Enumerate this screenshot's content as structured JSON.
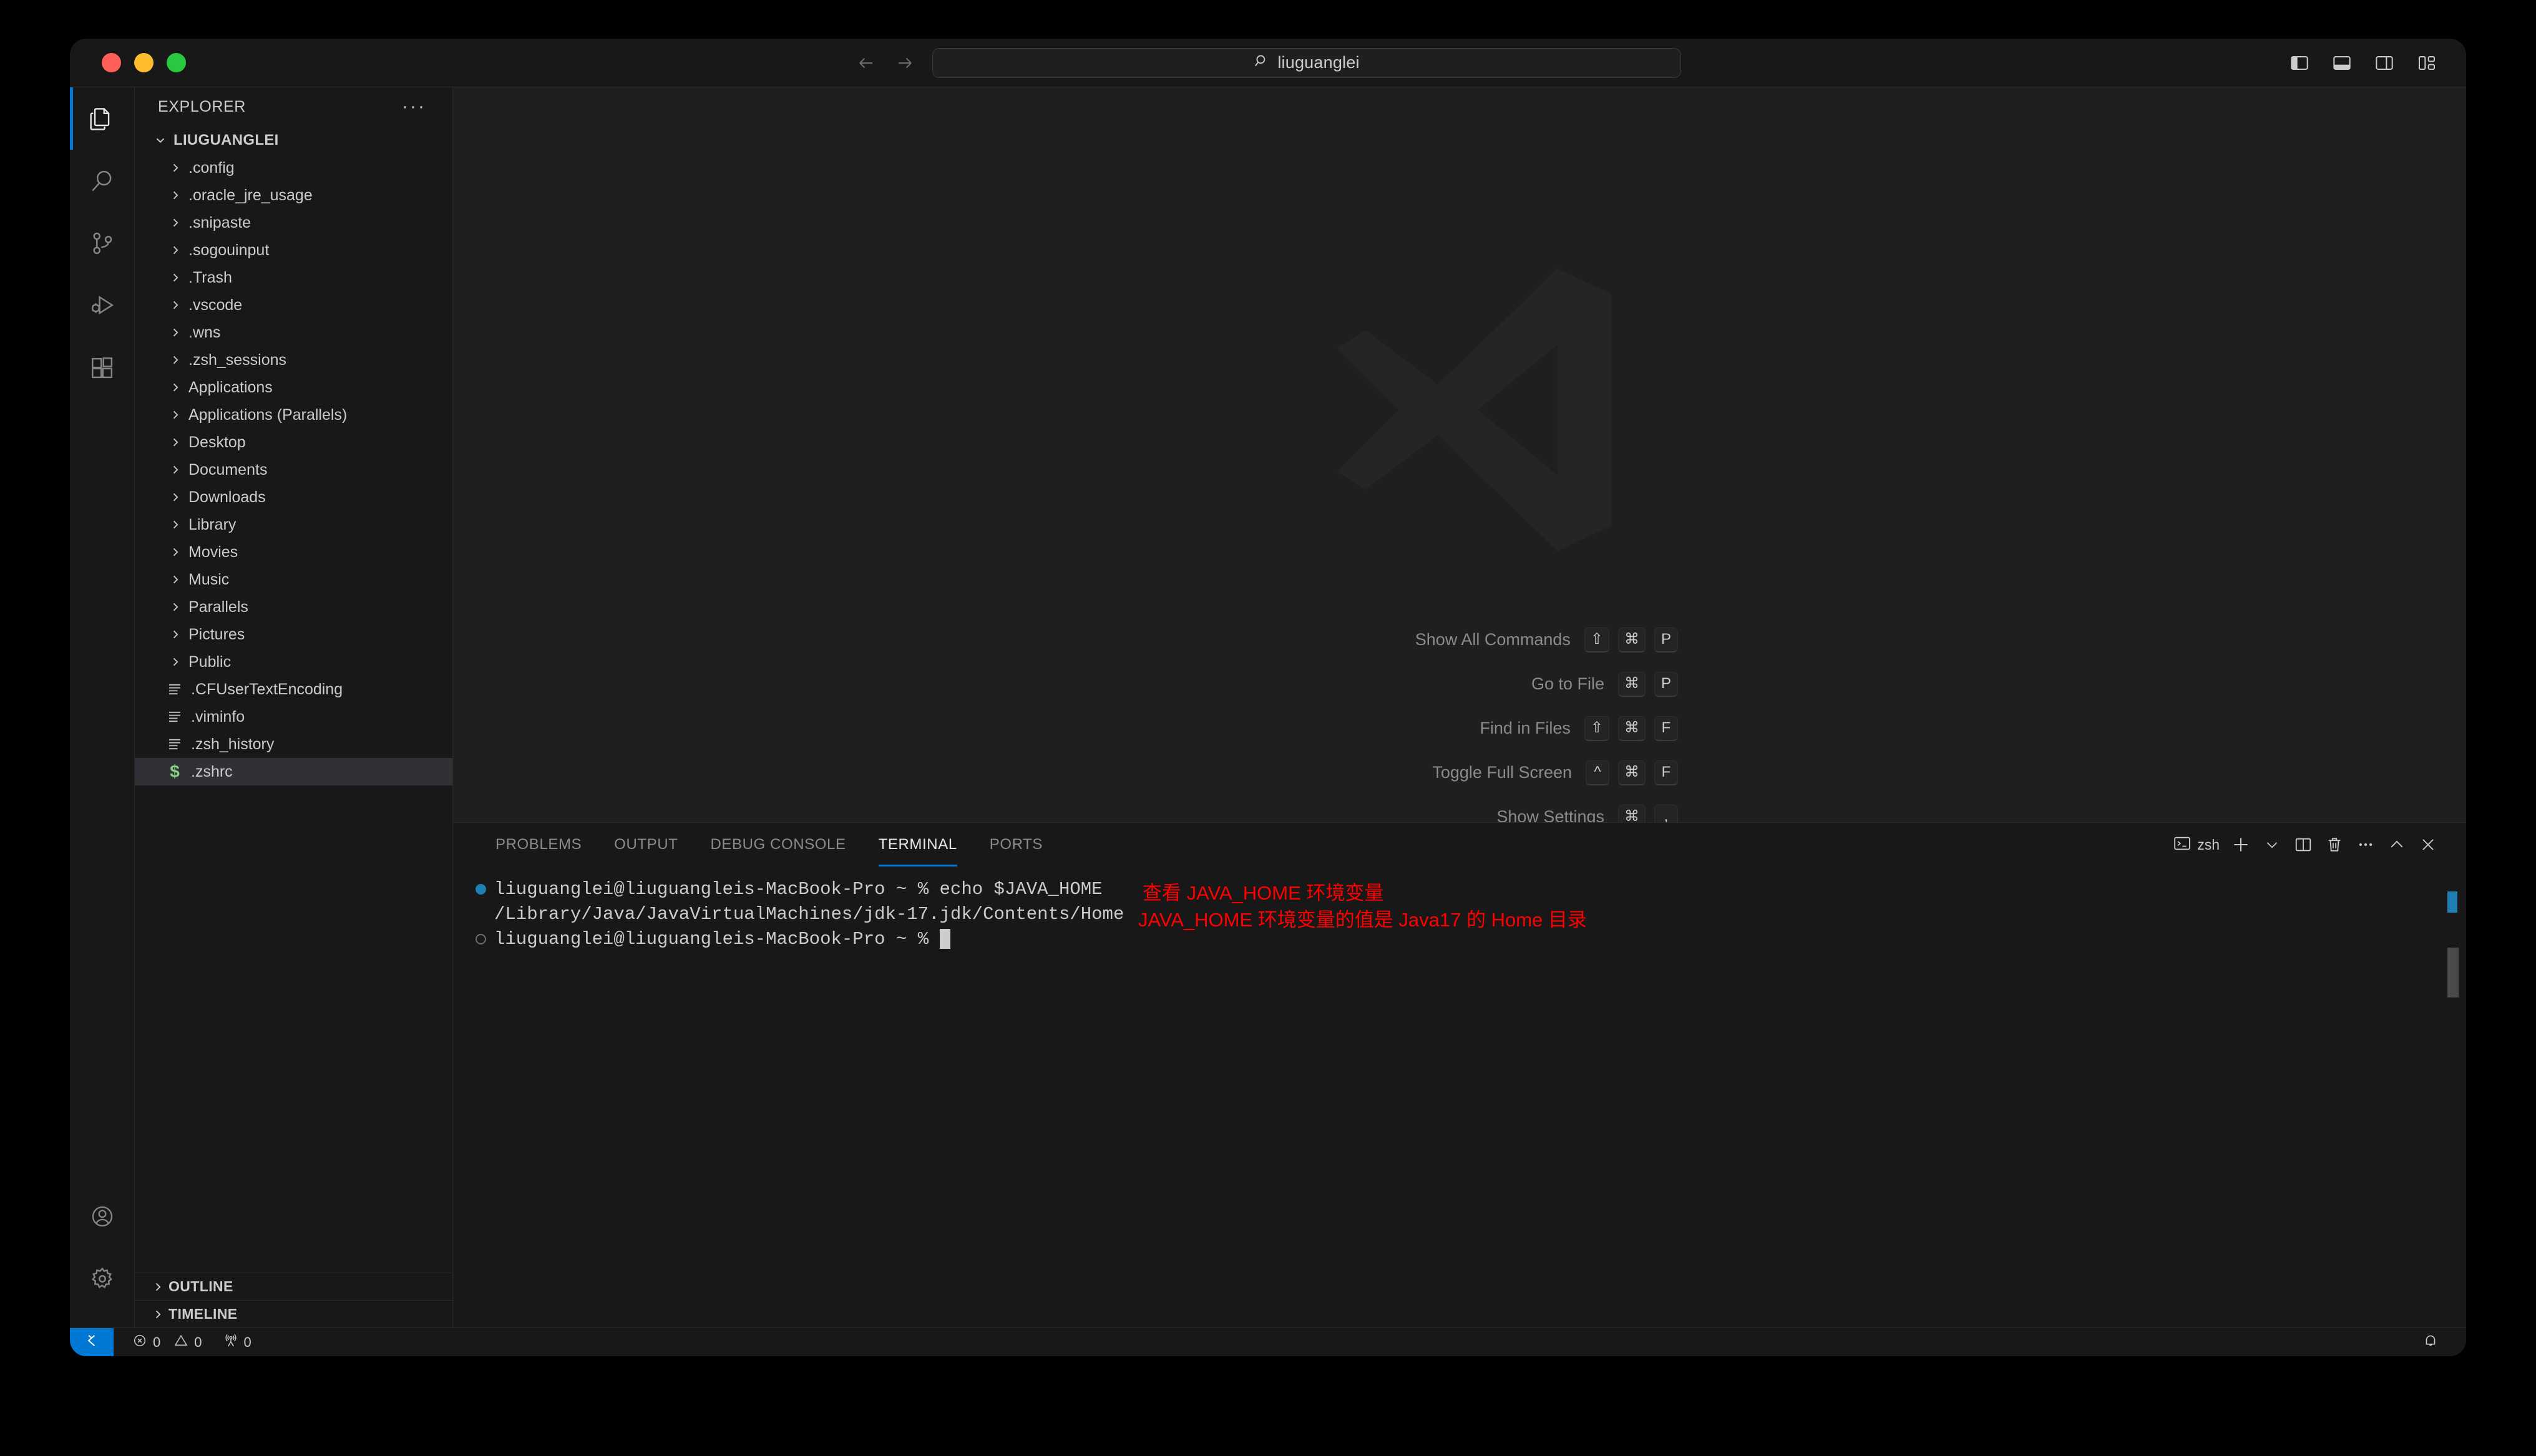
{
  "window": {
    "traffic_lights": [
      "close",
      "minimize",
      "zoom"
    ]
  },
  "titlebar": {
    "back_label": "Go Back",
    "forward_label": "Go Forward",
    "quick_open_value": "liuguanglei",
    "quick_open_icon": "search-icon",
    "layout_toggles": [
      {
        "name": "toggle-primary-sidebar",
        "label": "Toggle Primary Side Bar"
      },
      {
        "name": "toggle-panel",
        "label": "Toggle Panel"
      },
      {
        "name": "toggle-secondary-sidebar",
        "label": "Toggle Secondary Side Bar"
      },
      {
        "name": "customize-layout",
        "label": "Customize Layout"
      }
    ]
  },
  "activitybar": {
    "items": [
      {
        "label": "Explorer",
        "icon": "files-icon",
        "active": true
      },
      {
        "label": "Search",
        "icon": "search-icon",
        "active": false
      },
      {
        "label": "Source Control",
        "icon": "source-control-icon",
        "active": false
      },
      {
        "label": "Run and Debug",
        "icon": "run-debug-icon",
        "active": false
      },
      {
        "label": "Extensions",
        "icon": "extensions-icon",
        "active": false
      }
    ],
    "bottom": [
      {
        "label": "Accounts",
        "icon": "account-icon"
      },
      {
        "label": "Manage",
        "icon": "gear-icon"
      }
    ]
  },
  "sidebar": {
    "title": "EXPLORER",
    "more_actions": "···",
    "root_folder": "LIUGUANGLEI",
    "tree": [
      {
        "label": ".config",
        "type": "folder"
      },
      {
        "label": ".oracle_jre_usage",
        "type": "folder"
      },
      {
        "label": ".snipaste",
        "type": "folder"
      },
      {
        "label": ".sogouinput",
        "type": "folder"
      },
      {
        "label": ".Trash",
        "type": "folder"
      },
      {
        "label": ".vscode",
        "type": "folder"
      },
      {
        "label": ".wns",
        "type": "folder"
      },
      {
        "label": ".zsh_sessions",
        "type": "folder"
      },
      {
        "label": "Applications",
        "type": "folder"
      },
      {
        "label": "Applications (Parallels)",
        "type": "folder"
      },
      {
        "label": "Desktop",
        "type": "folder"
      },
      {
        "label": "Documents",
        "type": "folder"
      },
      {
        "label": "Downloads",
        "type": "folder"
      },
      {
        "label": "Library",
        "type": "folder"
      },
      {
        "label": "Movies",
        "type": "folder"
      },
      {
        "label": "Music",
        "type": "folder"
      },
      {
        "label": "Parallels",
        "type": "folder"
      },
      {
        "label": "Pictures",
        "type": "folder"
      },
      {
        "label": "Public",
        "type": "folder"
      },
      {
        "label": ".CFUserTextEncoding",
        "type": "file"
      },
      {
        "label": ".viminfo",
        "type": "file"
      },
      {
        "label": ".zsh_history",
        "type": "file"
      },
      {
        "label": ".zshrc",
        "type": "shellfile",
        "selected": true
      }
    ],
    "sections": [
      {
        "label": "OUTLINE",
        "expanded": false
      },
      {
        "label": "TIMELINE",
        "expanded": false
      }
    ]
  },
  "editor": {
    "watermark_icon": "vscode-logo",
    "shortcuts": [
      {
        "label": "Show All Commands",
        "keys": [
          "⇧",
          "⌘",
          "P"
        ]
      },
      {
        "label": "Go to File",
        "keys": [
          "⌘",
          "P"
        ]
      },
      {
        "label": "Find in Files",
        "keys": [
          "⇧",
          "⌘",
          "F"
        ]
      },
      {
        "label": "Toggle Full Screen",
        "keys": [
          "^",
          "⌘",
          "F"
        ]
      },
      {
        "label": "Show Settings",
        "keys": [
          "⌘",
          ","
        ]
      }
    ]
  },
  "panel": {
    "tabs": [
      {
        "label": "PROBLEMS",
        "active": false
      },
      {
        "label": "OUTPUT",
        "active": false
      },
      {
        "label": "DEBUG CONSOLE",
        "active": false
      },
      {
        "label": "TERMINAL",
        "active": true
      },
      {
        "label": "PORTS",
        "active": false
      }
    ],
    "actions": [
      {
        "name": "terminal-shell-indicator",
        "label": "zsh",
        "icon": "terminal-icon"
      },
      {
        "name": "new-terminal-button",
        "label": "",
        "icon": "plus-icon"
      },
      {
        "name": "terminal-profile-dropdown",
        "label": "",
        "icon": "chevron-down-icon"
      },
      {
        "name": "split-terminal-button",
        "label": "",
        "icon": "split-icon"
      },
      {
        "name": "kill-terminal-button",
        "label": "",
        "icon": "trash-icon"
      },
      {
        "name": "panel-more-actions-button",
        "label": "",
        "icon": "ellipsis-icon"
      },
      {
        "name": "maximize-panel-button",
        "label": "",
        "icon": "chevron-up-icon"
      },
      {
        "name": "close-panel-button",
        "label": "",
        "icon": "close-icon"
      }
    ],
    "terminal": {
      "lines": [
        {
          "marker": "success",
          "text": "liuguanglei@liuguangleis-MacBook-Pro ~ % echo $JAVA_HOME",
          "annotation": "查看 JAVA_HOME 环境变量"
        },
        {
          "marker": "none",
          "text": "/Library/Java/JavaVirtualMachines/jdk-17.jdk/Contents/Home",
          "annotation": "JAVA_HOME 环境变量的值是 Java17 的 Home 目录"
        },
        {
          "marker": "pending",
          "text": "liuguanglei@liuguangleis-MacBook-Pro ~ % ",
          "cursor": true,
          "annotation": ""
        }
      ]
    }
  },
  "statusbar": {
    "remote_label": "",
    "remote_icon": "remote-host-icon",
    "errors_icon": "error-icon",
    "errors_count": "0",
    "warnings_icon": "warning-icon",
    "warnings_count": "0",
    "ports_icon": "radio-tower-icon",
    "ports_count": "0",
    "notifications_icon": "bell-icon"
  },
  "colors": {
    "accent_blue": "#0078d4",
    "annotation_red": "#ff0000",
    "shell_green": "#89d185",
    "prompt_blue": "#1f7fb5",
    "panel_bg": "#181818",
    "editor_bg": "#1f1f1f"
  }
}
